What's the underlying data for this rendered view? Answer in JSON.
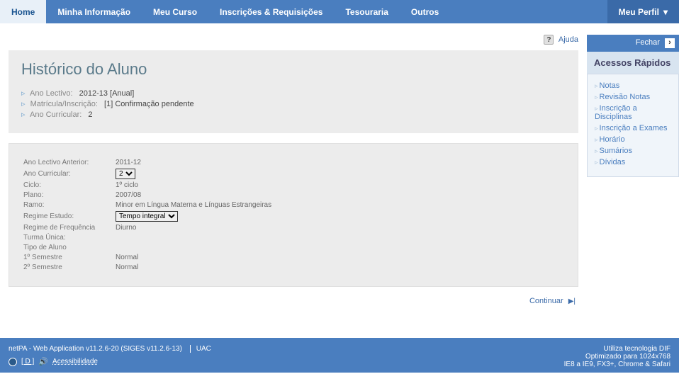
{
  "nav": {
    "home": "Home",
    "info": "Minha Informação",
    "curso": "Meu Curso",
    "inscricoes": "Inscrições & Requisições",
    "tesouraria": "Tesouraria",
    "outros": "Outros",
    "perfil": "Meu Perfil"
  },
  "help": {
    "label": "Ajuda"
  },
  "title": "Histórico do Aluno",
  "meta": {
    "ano_lectivo_lbl": "Ano Lectivo:",
    "ano_lectivo_val": "2012-13 [Anual]",
    "matricula_lbl": "Matrícula/Inscrição:",
    "matricula_val": "[1] Confirmação pendente",
    "ano_curricular_lbl": "Ano Curricular:",
    "ano_curricular_val": "2"
  },
  "details": {
    "rows": [
      {
        "lbl": "Ano Lectivo Anterior:",
        "val": "2011-12"
      },
      {
        "lbl": "Ano Curricular:",
        "sel": "2"
      },
      {
        "lbl": "Ciclo:",
        "val": "1º ciclo"
      },
      {
        "lbl": "Plano:",
        "val": "2007/08"
      },
      {
        "lbl": "Ramo:",
        "val": "Minor em Língua Materna e Línguas Estrangeiras"
      },
      {
        "lbl": "Regime Estudo:",
        "sel": "Tempo integral"
      },
      {
        "lbl": "Regime de Frequência",
        "val": "Diurno"
      },
      {
        "lbl": "Turma Única:",
        "val": ""
      },
      {
        "lbl": "Tipo de Aluno",
        "val": ""
      },
      {
        "lbl": "1º Semestre",
        "val": "Normal"
      },
      {
        "lbl": "2º Semestre",
        "val": "Normal"
      }
    ]
  },
  "continue": "Continuar",
  "sidebar": {
    "close": "Fechar",
    "title": "Acessos Rápidos",
    "items": [
      "Notas",
      "Revisão Notas",
      "Inscrição a Disciplinas",
      "Inscrição a Exames",
      "Horário",
      "Sumários",
      "Dívidas"
    ]
  },
  "footer": {
    "app": "netPA - Web Application v11.2.6-20 (SIGES v11.2.6-13)",
    "uac": "UAC",
    "d": "[ D ]",
    "access": "Acessibilidade",
    "tech": "Utiliza tecnologia DIF",
    "opt": "Optimizado para 1024x768",
    "browsers": "IE8 a IE9, FX3+, Chrome & Safari"
  }
}
